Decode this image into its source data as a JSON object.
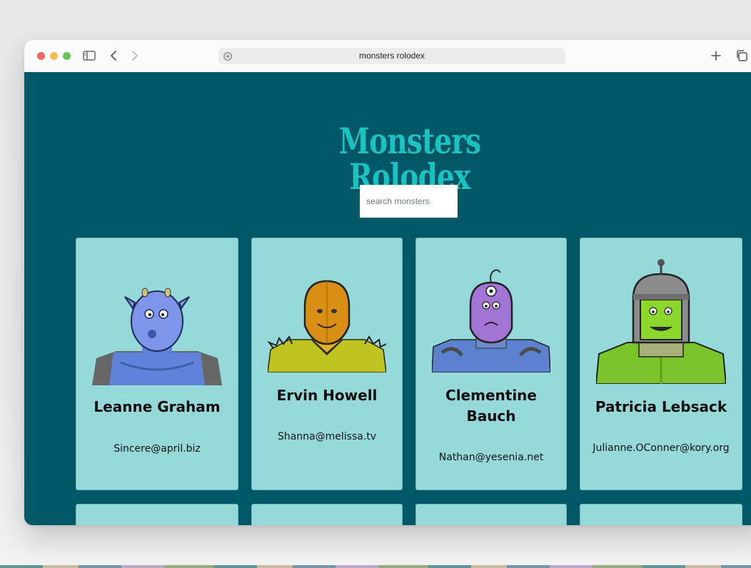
{
  "browser": {
    "url": "monsters rolodex",
    "icons": [
      "sidebar-icon",
      "back-icon",
      "forward-icon",
      "shield-icon",
      "new-tab-icon",
      "tabs-overview-icon"
    ]
  },
  "app": {
    "title": "Monsters Rolodex",
    "search_placeholder": "search monsters"
  },
  "monsters": [
    {
      "name": "Leanne Graham",
      "email": "Sincere@april.biz"
    },
    {
      "name": "Ervin Howell",
      "email": "Shanna@melissa.tv"
    },
    {
      "name": "Clementine Bauch",
      "email": "Nathan@yesenia.net"
    },
    {
      "name": "Patricia Lebsack",
      "email": "Julianne.OConner@kory.org"
    }
  ],
  "colors": {
    "background": "#005866",
    "title": "#19c3c3",
    "card": "#95d9db"
  }
}
